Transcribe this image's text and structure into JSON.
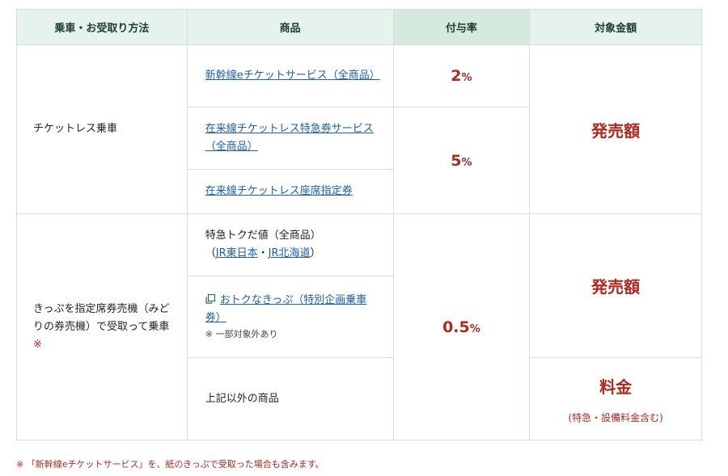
{
  "headers": {
    "method": "乗車・お受取り方法",
    "product": "商品",
    "rate": "付与率",
    "amount": "対象金額"
  },
  "rows": {
    "ticketless": {
      "method": "チケットレス乗車",
      "products": [
        "新幹線eチケットサービス（全商品）",
        "在来線チケットレス特急券サービス（全商品）",
        "在来線チケットレス座席指定券"
      ],
      "rate_a": {
        "value": "2",
        "unit": "%"
      },
      "rate_b": {
        "value": "5",
        "unit": "%"
      },
      "amount": "発売額"
    },
    "kippu": {
      "method": "きっぷを指定席券売機（みどりの券売機）で受取って乗車",
      "method_mark": "※",
      "product_1_text": "特急トクだ値（全商品）",
      "product_1_open": "（",
      "product_1_link1": "JR東日本",
      "product_1_sep": "・",
      "product_1_link2": "JR北海道",
      "product_1_close": "）",
      "product_2": "おトクなきっぷ（特別企画乗車券）",
      "product_2_note": "※ 一部対象外あり",
      "product_3": "上記以外の商品",
      "rate": {
        "value": "0.5",
        "unit": "%"
      },
      "amount_1": "発売額",
      "amount_2": "料金",
      "amount_2_sub": "(特急・設備料金含む)"
    }
  },
  "footnote": "※ 「新幹線eチケットサービス」を、紙のきっぷで受取った場合も含みます。",
  "icons": {
    "external_copy": "copy-icon"
  },
  "colors": {
    "header_bg": "#e6f2ec",
    "header_alt_bg": "#d5e9de",
    "accent_red": "#b0281e",
    "link_blue": "#1a5fb4"
  }
}
